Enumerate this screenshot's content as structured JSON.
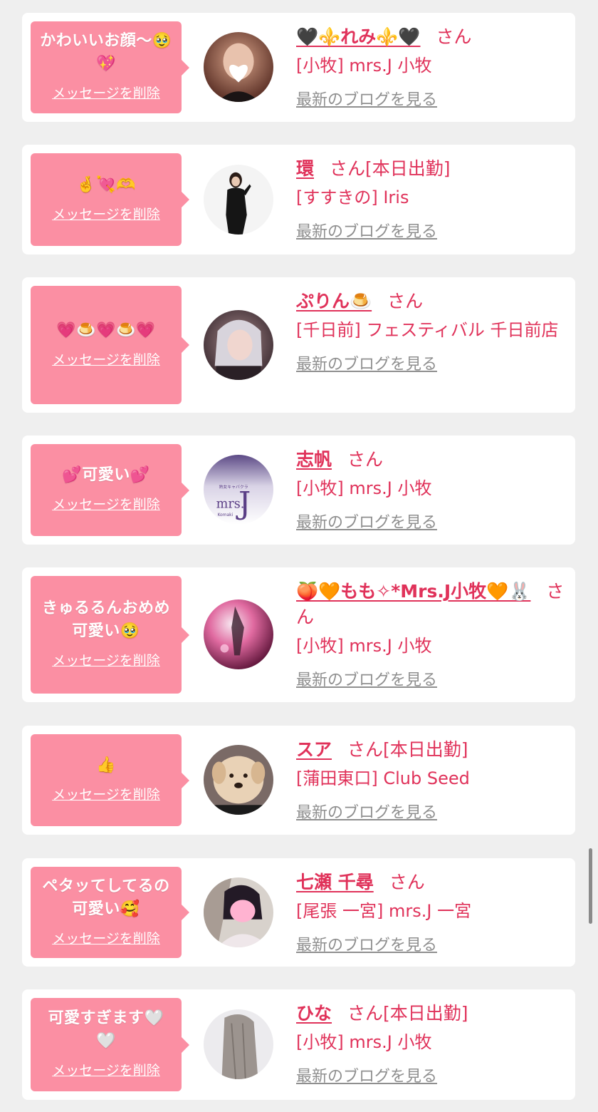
{
  "items": [
    {
      "message": "かわいいお顔〜🥹\n💖",
      "delete_label": "メッセージを削除",
      "name": "🖤⚜️れみ⚜️🖤",
      "honorific": "さん",
      "status": "",
      "shop": "[小牧] mrs.J 小牧",
      "blog_label": "最新のブログを見る",
      "avatar_icon": "girl-photo-heart-sticker"
    },
    {
      "message": "🤞💘🫶",
      "delete_label": "メッセージを削除",
      "name": "環",
      "honorific": "さん",
      "status": "[本日出勤]",
      "shop": "[すすきの] Iris",
      "blog_label": "最新のブログを見る",
      "avatar_icon": "woman-in-black-dress"
    },
    {
      "message": "💗🍮💗🍮💗",
      "delete_label": "メッセージを削除",
      "name": "ぷりん🍮",
      "honorific": "さん",
      "status": "",
      "shop": "[千日前] フェスティバル 千日前店",
      "blog_label": "最新のブログを見る",
      "avatar_icon": "girl-silver-hair"
    },
    {
      "message": "💕可愛い💕",
      "delete_label": "メッセージを削除",
      "name": "志帆",
      "honorific": "さん",
      "status": "",
      "shop": "[小牧] mrs.J 小牧",
      "blog_label": "最新のブログを見る",
      "avatar_icon": "mrs-j-logo",
      "avatar_logo_small": "熟女キャバクラ",
      "avatar_logo_text": "mrs.",
      "avatar_logo_letter": "J",
      "avatar_logo_sub": "Komaki"
    },
    {
      "message": "きゅるるんおめめ\n可愛い🥹",
      "delete_label": "メッセージを削除",
      "name": "🍑🧡もも✧*Mrs.J小牧🧡🐰",
      "honorific": "さん",
      "status": "",
      "shop": "[小牧] mrs.J 小牧",
      "blog_label": "最新のブログを見る",
      "avatar_icon": "pink-neon-photo"
    },
    {
      "message": "👍",
      "delete_label": "メッセージを削除",
      "name": "スア",
      "honorific": "さん",
      "status": "[本日出勤]",
      "shop": "[蒲田東口] Club Seed",
      "blog_label": "最新のブログを見る",
      "avatar_icon": "dog-filter-photo"
    },
    {
      "message": "ペタッてしてるの\n可愛い🥰",
      "delete_label": "メッセージを削除",
      "name": "七瀬 千尋",
      "honorific": "さん",
      "status": "",
      "shop": "[尾張 一宮] mrs.J 一宮",
      "blog_label": "最新のブログを見る",
      "avatar_icon": "girl-pink-blur-face"
    },
    {
      "message": "可愛すぎます🤍\n🤍",
      "delete_label": "メッセージを削除",
      "name": "ひな",
      "honorific": "さん",
      "status": "[本日出勤]",
      "shop": "[小牧] mrs.J 小牧",
      "blog_label": "最新のブログを見る",
      "avatar_icon": "girl-long-hair-back"
    }
  ],
  "colors": {
    "bubble": "#fb8fa3",
    "accent": "#e0325a",
    "link_gray": "#8f8f8f",
    "background": "#efefef"
  }
}
